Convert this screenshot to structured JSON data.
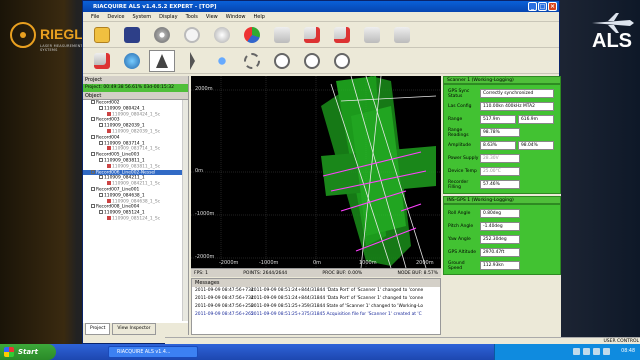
{
  "brand": {
    "left_name": "RIEGL",
    "left_tag": "LASER MEASUREMENT SYSTEMS",
    "right_name": "ALS"
  },
  "window": {
    "title": "RIACQUIRE ALS v1.4.5.2 EXPERT - [TOP]"
  },
  "menu": [
    "File",
    "Device",
    "System",
    "Display",
    "Tools",
    "View",
    "Window",
    "Help"
  ],
  "toolbar": {
    "row1": [
      "open-folder-icon",
      "save-icon",
      "settings-wheel-icon",
      "power-icon",
      "globe-record-icon",
      "scanner-1-icon",
      "scanner-2-icon",
      "scanner-3-icon",
      "scanner-4-icon",
      "scanner-5-icon"
    ],
    "row2": [
      "scanner-settings-icon",
      "globe-icon",
      "north-arrow-icon",
      "pointer-icon",
      "pan-icon",
      "zoom-window-icon",
      "zoom-in-icon",
      "zoom-out-icon",
      "zoom-fit-icon"
    ]
  },
  "project": {
    "header": "Project",
    "status": "Project: 00:49:38 56.61% 03d-00:15:32",
    "object_header": "Object",
    "tree": [
      {
        "text": "Record002",
        "kind": "record"
      },
      {
        "text": "110909_080424_1",
        "kind": "item"
      },
      {
        "text": "110909_080424_1_Sc",
        "kind": "sub"
      },
      {
        "text": "Record003",
        "kind": "record"
      },
      {
        "text": "110909_082039_1",
        "kind": "item"
      },
      {
        "text": "110909_082039_1_Sc",
        "kind": "sub"
      },
      {
        "text": "Record004",
        "kind": "record"
      },
      {
        "text": "110909_083714_1",
        "kind": "item"
      },
      {
        "text": "110909_083714_1_Sc",
        "kind": "sub"
      },
      {
        "text": "Record005_Line003",
        "kind": "record"
      },
      {
        "text": "110909_083811_1",
        "kind": "item"
      },
      {
        "text": "110909_083811_1_Sc",
        "kind": "sub"
      },
      {
        "text": "Record006_Line002-Nessel",
        "kind": "selected"
      },
      {
        "text": "110909_084211_1",
        "kind": "item"
      },
      {
        "text": "110909_084211_1_Sc",
        "kind": "sub"
      },
      {
        "text": "Record007_Line001",
        "kind": "record"
      },
      {
        "text": "110909_084638_1",
        "kind": "item"
      },
      {
        "text": "110909_084638_1_Sc",
        "kind": "sub"
      },
      {
        "text": "Record008_Line004",
        "kind": "record"
      },
      {
        "text": "110909_085124_1",
        "kind": "item"
      },
      {
        "text": "110909_085124_1_Sc",
        "kind": "sub"
      }
    ],
    "tabs": [
      "Project",
      "View Inspector"
    ]
  },
  "viewport": {
    "axis_labels": {
      "y_top": "2000m",
      "y_mid": "0m",
      "y_bot": "-1000m",
      "y_bot2": "-2000m",
      "x_left": "-2000m",
      "x_mid1": "-1000m",
      "x_mid2": "0m",
      "x_mid3": "1000m",
      "x_right": "2000m"
    },
    "status": {
      "fps": "FPS: 1",
      "points": "POINTS: 2644/2644",
      "proc_buf": "PROC BUF: 0.00%",
      "node_buf": "NODE BUF: 8.57%"
    }
  },
  "messages": {
    "header": "Messages",
    "rows": [
      {
        "ts": "2011-09-09 08:47:56+734",
        "text": "2011-09-09 08:51:24+844/31844 'Data Port' of 'Scanner 1' changed to 'conne",
        "hl": false
      },
      {
        "ts": "2011-09-09 08:47:56+734",
        "text": "2011-09-09 08:51:24+844/31844 'Data Port' of 'Scanner 1' changed to 'conne",
        "hl": false
      },
      {
        "ts": "2011-09-09 08:47:56+250",
        "text": "2011-09-09 08:51:25+359/31844 State of 'Scanner 1' changed to 'Working-Lo",
        "hl": false
      },
      {
        "ts": "2011-09-09 08:47:56+265",
        "text": "2011-09-09 08:51:25+375/31845 Acquisition file for 'Scanner 1' created at 'C",
        "hl": true
      }
    ]
  },
  "scanner": {
    "header": "Scanner 1 (Working-Logging)",
    "fields": [
      {
        "label": "GPS Sync Status",
        "values": [
          "Correctly synchronized"
        ]
      },
      {
        "label": "Las Config",
        "values": [
          "110.00kn 400kHz MTA2"
        ]
      },
      {
        "label": "Range",
        "values": [
          "517.9m",
          "616.9m"
        ]
      },
      {
        "label": "Range Readings",
        "values": [
          "98.78%"
        ]
      },
      {
        "label": "Amplitude",
        "values": [
          "8.63%",
          "98.04%"
        ]
      },
      {
        "label": "Power Supply",
        "values": [
          "28.30V"
        ],
        "disabled": true
      },
      {
        "label": "Device Temp",
        "values": [
          "25.00°C"
        ],
        "disabled": true
      },
      {
        "label": "Recorder Filling",
        "values": [
          "57.46%"
        ]
      }
    ]
  },
  "ins": {
    "header": "INS-GPS 1 (Working-Logging)",
    "fields": [
      {
        "label": "Roll Angle",
        "values": [
          "0.80deg"
        ]
      },
      {
        "label": "Pitch Angle",
        "values": [
          "-1.40deg"
        ]
      },
      {
        "label": "Yaw Angle",
        "values": [
          "252.30deg"
        ]
      },
      {
        "label": "GPS Altitude",
        "values": [
          "2970.47ft"
        ]
      },
      {
        "label": "Ground Speed",
        "values": [
          "112.93kn"
        ]
      }
    ]
  },
  "bottom_status": "USER CONTROL",
  "taskbar": {
    "start": "Start",
    "task": "RIACQUIRE ALS v1.4...",
    "clock": "08:48"
  },
  "colors": {
    "accent_green": "#42c232",
    "title_blue": "#0a60d8",
    "strip_green": "#1fb11f",
    "trajectory": "#ff40ff"
  }
}
